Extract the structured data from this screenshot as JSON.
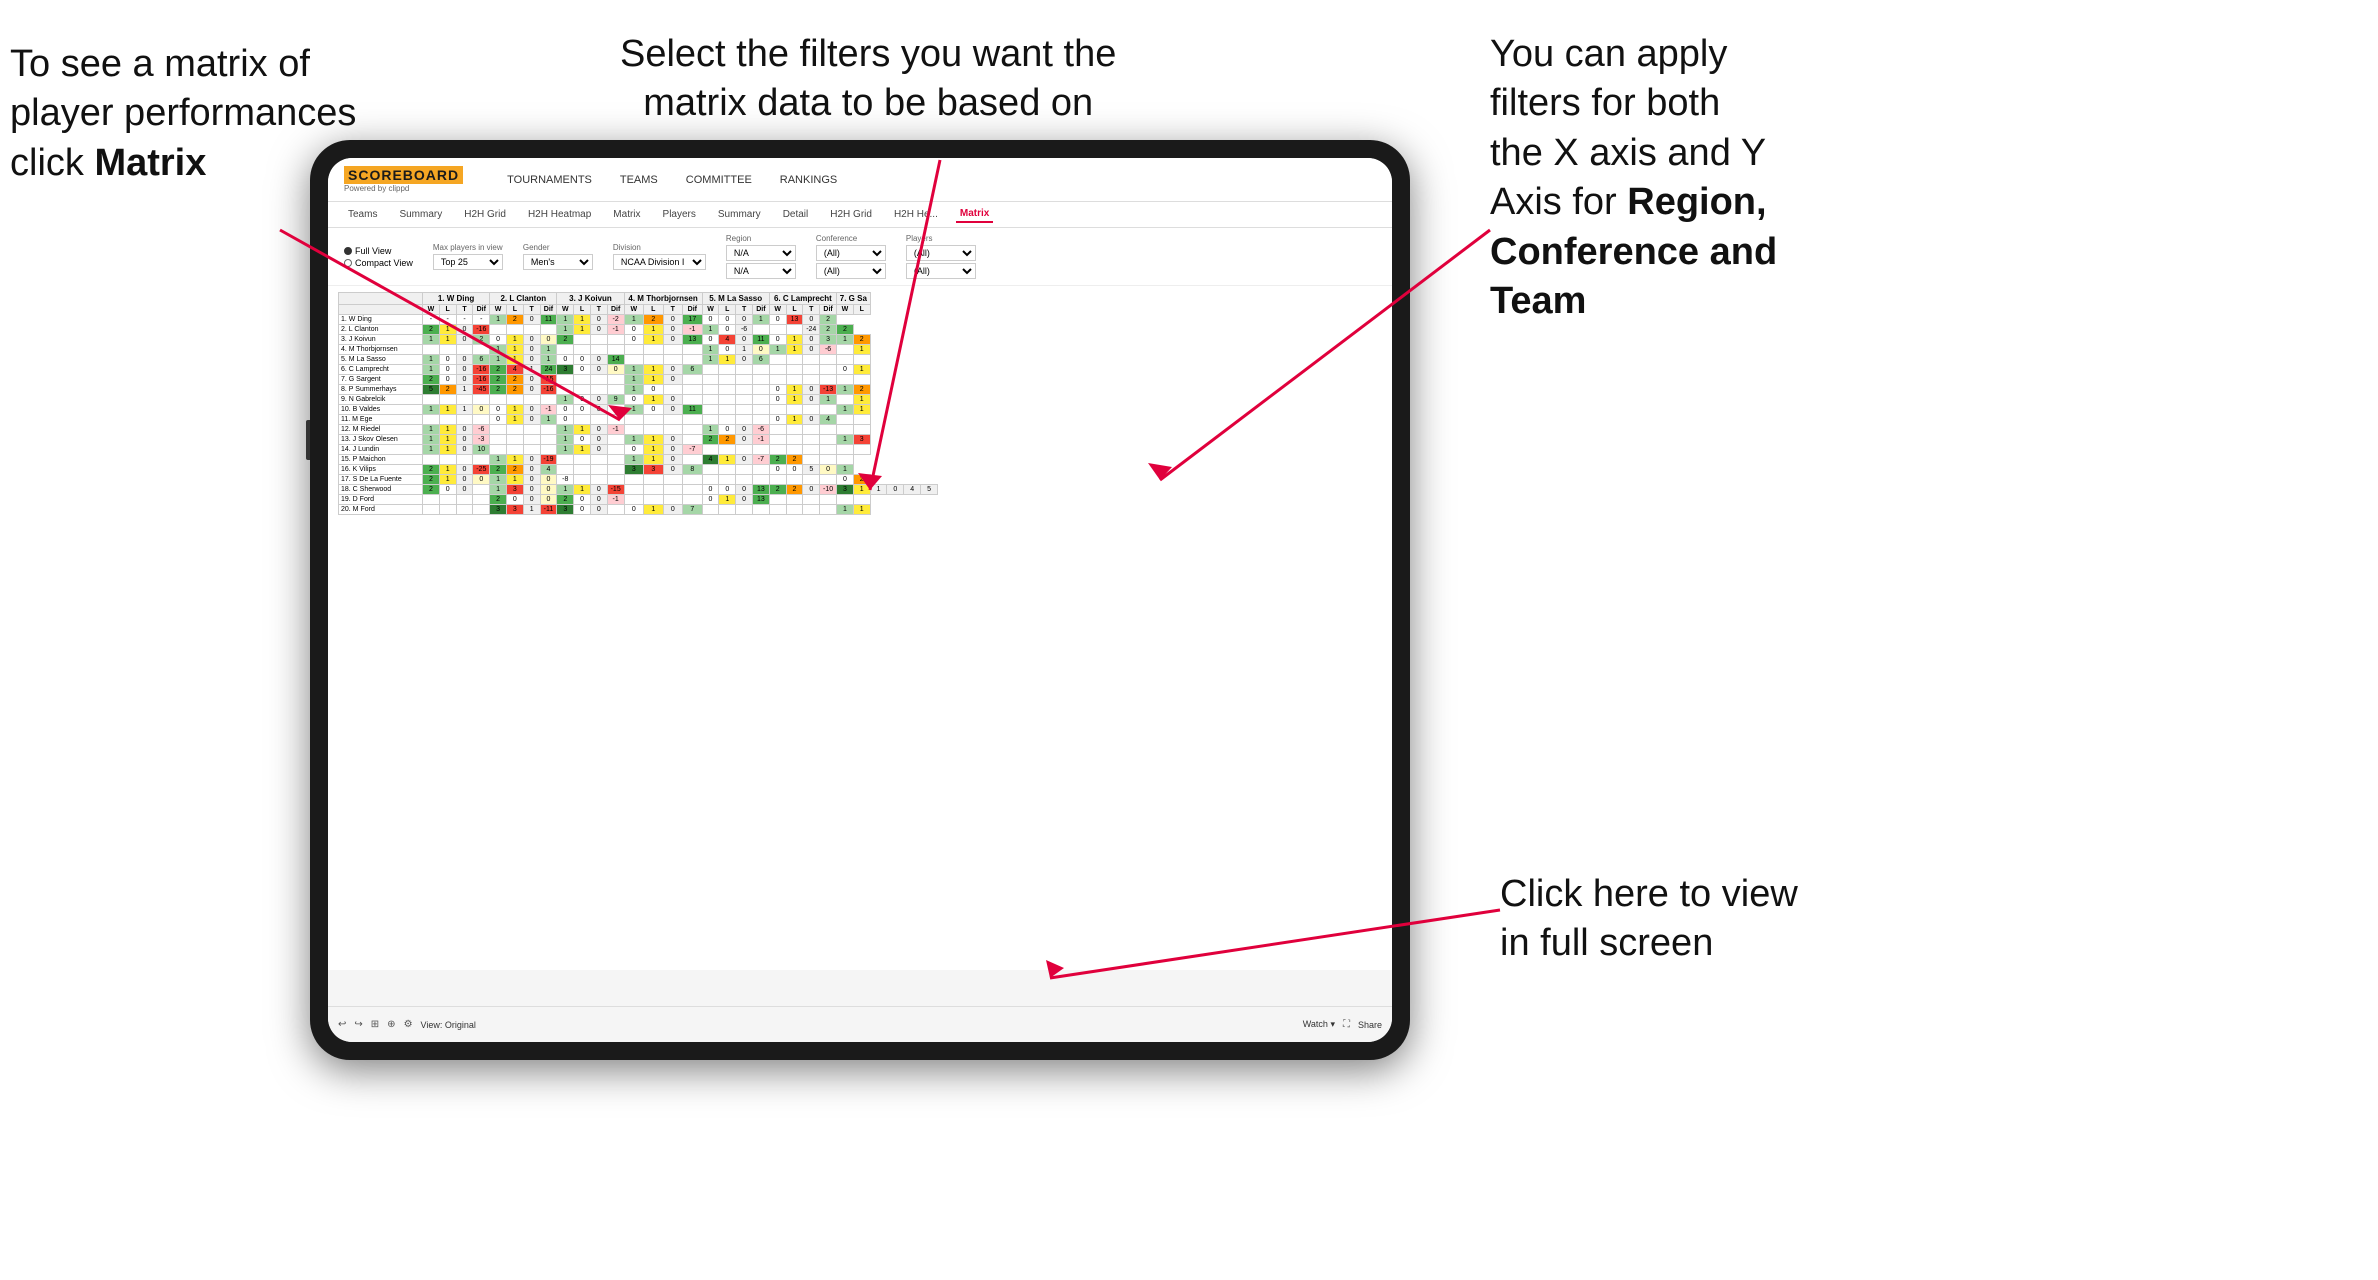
{
  "annotations": {
    "top_left": {
      "line1": "To see a matrix of",
      "line2": "player performances",
      "line3_prefix": "click ",
      "line3_bold": "Matrix"
    },
    "top_center": {
      "line1": "Select the filters you want the",
      "line2": "matrix data to be based on"
    },
    "top_right": {
      "line1": "You  can apply",
      "line2": "filters for both",
      "line3": "the X axis and Y",
      "line4_prefix": "Axis for ",
      "line4_bold": "Region,",
      "line5_bold": "Conference and",
      "line6_bold": "Team"
    },
    "bottom_right": {
      "line1": "Click here to view",
      "line2": "in full screen"
    }
  },
  "app": {
    "logo_main": "SCOREBOARD",
    "logo_sub": "Powered by clippd",
    "nav": [
      "TOURNAMENTS",
      "TEAMS",
      "COMMITTEE",
      "RANKINGS"
    ],
    "tabs": [
      "Teams",
      "Summary",
      "H2H Grid",
      "H2H Heatmap",
      "Matrix",
      "Players",
      "Summary",
      "Detail",
      "H2H Grid",
      "H2H He...",
      "Matrix"
    ],
    "active_tab": "Matrix"
  },
  "filters": {
    "view_options": [
      "Full View",
      "Compact View"
    ],
    "selected_view": "Full View",
    "max_players_label": "Max players in view",
    "max_players_value": "Top 25",
    "gender_label": "Gender",
    "gender_value": "Men's",
    "division_label": "Division",
    "division_value": "NCAA Division I",
    "region_label": "Region",
    "region_values": [
      "N/A",
      "N/A"
    ],
    "conference_label": "Conference",
    "conference_values": [
      "(All)",
      "(All)"
    ],
    "players_label": "Players",
    "players_values": [
      "(All)",
      "(All)"
    ]
  },
  "matrix": {
    "column_groups": [
      {
        "name": "1. W Ding",
        "cols": [
          "W",
          "L",
          "T",
          "Dif"
        ]
      },
      {
        "name": "2. L Clanton",
        "cols": [
          "W",
          "L",
          "T",
          "Dif"
        ]
      },
      {
        "name": "3. J Koivun",
        "cols": [
          "W",
          "L",
          "T",
          "Dif"
        ]
      },
      {
        "name": "4. M Thorbjornsen",
        "cols": [
          "W",
          "L",
          "T",
          "Dif"
        ]
      },
      {
        "name": "5. M La Sasso",
        "cols": [
          "W",
          "L",
          "T",
          "Dif"
        ]
      },
      {
        "name": "6. C Lamprecht",
        "cols": [
          "W",
          "L",
          "T",
          "Dif"
        ]
      },
      {
        "name": "7. G Sa",
        "cols": [
          "W",
          "L"
        ]
      }
    ],
    "rows": [
      {
        "name": "1. W Ding",
        "data": [
          "-",
          "-",
          "-",
          "-",
          "1",
          "2",
          "0",
          "11",
          "1",
          "1",
          "0",
          "-2",
          "1",
          "2",
          "0",
          "17",
          "0",
          "0",
          "0",
          "1",
          "0",
          "13",
          "0",
          "2"
        ]
      },
      {
        "name": "2. L Clanton",
        "data": [
          "2",
          "1",
          "0",
          "-16",
          "",
          "",
          "",
          "",
          "1",
          "1",
          "0",
          "-1",
          "0",
          "1",
          "0",
          "-1",
          "1",
          "0",
          "-6",
          "",
          "",
          "",
          "-24",
          "2",
          "2"
        ]
      },
      {
        "name": "3. J Koivun",
        "data": [
          "1",
          "1",
          "0",
          "2",
          "0",
          "1",
          "0",
          "0",
          "2",
          "",
          "",
          "",
          "0",
          "1",
          "0",
          "13",
          "0",
          "4",
          "0",
          "11",
          "0",
          "1",
          "0",
          "3",
          "1",
          "2"
        ]
      },
      {
        "name": "4. M Thorbjornsen",
        "data": [
          "",
          "",
          "",
          "",
          "1",
          "1",
          "0",
          "1",
          "",
          "",
          "",
          "",
          "",
          "",
          "",
          "",
          "1",
          "0",
          "1",
          "0",
          "1",
          "1",
          "0",
          "-6",
          "",
          "1"
        ]
      },
      {
        "name": "5. M La Sasso",
        "data": [
          "1",
          "0",
          "0",
          "6",
          "1",
          "1",
          "0",
          "1",
          "0",
          "0",
          "0",
          "14",
          "",
          "",
          "",
          "",
          "1",
          "1",
          "0",
          "6",
          "",
          "",
          "",
          "",
          "",
          ""
        ]
      },
      {
        "name": "6. C Lamprecht",
        "data": [
          "1",
          "0",
          "0",
          "-16",
          "2",
          "4",
          "1",
          "24",
          "3",
          "0",
          "0",
          "0",
          "1",
          "1",
          "0",
          "6",
          "",
          "",
          "",
          "",
          "",
          "",
          "",
          "",
          "0",
          "1"
        ]
      },
      {
        "name": "7. G Sargent",
        "data": [
          "2",
          "0",
          "0",
          "-16",
          "2",
          "2",
          "0",
          "-15",
          "",
          "",
          "",
          "",
          "1",
          "1",
          "0",
          "",
          "",
          "",
          "",
          "",
          "",
          "",
          "",
          "",
          "",
          ""
        ]
      },
      {
        "name": "8. P Summerhays",
        "data": [
          "5",
          "2",
          "1",
          "-45",
          "2",
          "2",
          "0",
          "-16",
          "",
          "",
          "",
          "",
          "1",
          "0",
          "",
          "",
          "",
          "",
          "",
          "",
          "0",
          "1",
          "0",
          "-13",
          "1",
          "2"
        ]
      },
      {
        "name": "9. N Gabrelcik",
        "data": [
          "",
          "",
          "",
          "",
          "",
          "",
          "",
          "",
          "1",
          "0",
          "0",
          "9",
          "0",
          "1",
          "0",
          "",
          "",
          "",
          "",
          "",
          "0",
          "1",
          "0",
          "1",
          "",
          "1"
        ]
      },
      {
        "name": "10. B Valdes",
        "data": [
          "1",
          "1",
          "1",
          "0",
          "0",
          "1",
          "0",
          "-1",
          "0",
          "0",
          "0",
          "",
          "1",
          "0",
          "0",
          "11",
          "",
          "",
          "",
          "",
          "",
          "",
          "",
          "",
          "1",
          "1"
        ]
      },
      {
        "name": "11. M Ege",
        "data": [
          "",
          "",
          "",
          "",
          "0",
          "1",
          "0",
          "1",
          "0",
          "",
          "",
          "",
          "",
          "",
          "",
          "",
          "",
          "",
          "",
          "",
          "0",
          "1",
          "0",
          "4",
          "",
          ""
        ]
      },
      {
        "name": "12. M Riedel",
        "data": [
          "1",
          "1",
          "0",
          "-6",
          "",
          "",
          "",
          "",
          "1",
          "1",
          "0",
          "-1",
          "",
          "",
          "",
          "",
          "1",
          "0",
          "0",
          "-6",
          "",
          "",
          "",
          "",
          "",
          ""
        ]
      },
      {
        "name": "13. J Skov Olesen",
        "data": [
          "1",
          "1",
          "0",
          "-3",
          "",
          "",
          "",
          "",
          "1",
          "0",
          "0",
          "",
          "1",
          "1",
          "0",
          "",
          "2",
          "2",
          "0",
          "-1",
          "",
          "",
          "",
          "",
          "1",
          "3"
        ]
      },
      {
        "name": "14. J Lundin",
        "data": [
          "1",
          "1",
          "0",
          "10",
          "",
          "",
          "",
          "",
          "1",
          "1",
          "0",
          "",
          "0",
          "1",
          "0",
          "-7",
          "",
          "",
          "",
          "",
          "",
          "",
          "",
          "",
          "",
          ""
        ]
      },
      {
        "name": "15. P Maichon",
        "data": [
          "",
          "",
          "",
          "",
          "1",
          "1",
          "0",
          "-19",
          "",
          "",
          "",
          "",
          "1",
          "1",
          "0",
          "",
          "4",
          "1",
          "0",
          "-7",
          "2",
          "2",
          "",
          "",
          ""
        ]
      },
      {
        "name": "16. K Vilips",
        "data": [
          "2",
          "1",
          "0",
          "-25",
          "2",
          "2",
          "0",
          "4",
          "",
          "",
          "",
          "",
          "3",
          "3",
          "0",
          "8",
          "",
          "",
          "",
          "",
          "0",
          "0",
          "5",
          "0",
          "1"
        ]
      },
      {
        "name": "17. S De La Fuente",
        "data": [
          "2",
          "1",
          "0",
          "0",
          "1",
          "1",
          "0",
          "0",
          "-8",
          "",
          "",
          "",
          "",
          "",
          "",
          "",
          "",
          "",
          "",
          "",
          "",
          "",
          "",
          "",
          "0",
          "2"
        ]
      },
      {
        "name": "18. C Sherwood",
        "data": [
          "2",
          "0",
          "0",
          "",
          "1",
          "3",
          "0",
          "0",
          "1",
          "1",
          "0",
          "-15",
          "",
          "",
          "",
          "",
          "0",
          "0",
          "0",
          "13",
          "2",
          "2",
          "0",
          "-10",
          "3",
          "1",
          "1",
          "0",
          "4",
          "5"
        ]
      },
      {
        "name": "19. D Ford",
        "data": [
          "",
          "",
          "",
          "",
          "2",
          "0",
          "0",
          "0",
          "2",
          "0",
          "0",
          "-1",
          "",
          "",
          "",
          "",
          "0",
          "1",
          "0",
          "13",
          "",
          "",
          "",
          "",
          "",
          ""
        ]
      },
      {
        "name": "20. M Ford",
        "data": [
          "",
          "",
          "",
          "",
          "3",
          "3",
          "1",
          "-11",
          "3",
          "0",
          "0",
          "",
          "0",
          "1",
          "0",
          "7",
          "",
          "",
          "",
          "",
          "",
          "",
          "",
          "",
          "1",
          "1"
        ]
      }
    ]
  },
  "toolbar": {
    "view_label": "View: Original",
    "watch_label": "Watch ▾",
    "share_label": "Share"
  },
  "colors": {
    "accent": "#e0003c",
    "dark_green": "#2e7d32",
    "green": "#4caf50",
    "light_green": "#a5d6a7",
    "yellow": "#ffeb3b",
    "orange": "#ff9800"
  }
}
